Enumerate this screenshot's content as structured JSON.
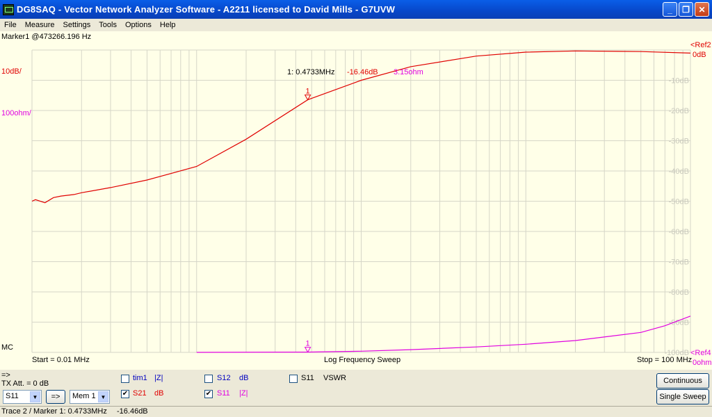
{
  "window": {
    "title": "DG8SAQ  -  Vector Network Analyzer Software  - A2211 licensed to David Mills - G7UVW",
    "minimize": "_",
    "maximize": "❐",
    "close": "✕"
  },
  "menu": [
    "File",
    "Measure",
    "Settings",
    "Tools",
    "Options",
    "Help"
  ],
  "plot": {
    "marker_header": "Marker1 @473266.196 Hz",
    "left_scale_db": "10dB/",
    "left_scale_ohm": "100ohm/",
    "mc_label": "MC",
    "ref2": "<Ref2",
    "ref2_val": "0dB",
    "ref4": "<Ref4",
    "ref4_val": "0ohm",
    "start": "Start = 0.01 MHz",
    "sweep_type": "Log Frequency Sweep",
    "stop": "Stop = 100 MHz",
    "marker_readout": {
      "freq": "1: 0.4733MHz",
      "db": "-16.46dB",
      "ohm": "3.15ohm"
    },
    "marker_label": "1",
    "db_ticks": [
      "-10dB",
      "-20dB",
      "-30dB",
      "-40dB",
      "-50dB",
      "-60dB",
      "-70dB",
      "-80dB",
      "-90dB",
      "-100dB"
    ],
    "colors": {
      "s21": "#e00000",
      "s11": "#e000e0",
      "grid": "#d6d6c8",
      "bg": "#ffffe8"
    }
  },
  "chart_data": {
    "type": "line",
    "xscale": "log",
    "xlim": [
      0.01,
      100
    ],
    "ylim": [
      -100,
      0
    ],
    "series": [
      {
        "name": "S21",
        "unit": "dB",
        "x": [
          0.01,
          0.0105,
          0.012,
          0.0135,
          0.015,
          0.018,
          0.02,
          0.03,
          0.05,
          0.1,
          0.2,
          0.4733,
          1,
          2,
          5,
          10,
          20,
          50,
          100
        ],
        "y": [
          -50,
          -49.5,
          -50.5,
          -48.8,
          -48.3,
          -47.8,
          -47.2,
          -45.5,
          -43,
          -38.5,
          -29.5,
          -16.46,
          -10,
          -5.5,
          -2,
          -0.7,
          -0.3,
          -0.5,
          -1
        ]
      },
      {
        "name": "S11",
        "unit": "|Z|",
        "x": [
          0.1,
          0.4733,
          1,
          2,
          5,
          10,
          20,
          50,
          70,
          100
        ],
        "y": [
          -100,
          -99.9,
          -99.6,
          -99.1,
          -98.2,
          -97.3,
          -96.1,
          -93.4,
          -91.2,
          -88
        ]
      }
    ]
  },
  "controls": {
    "arrow": "=>",
    "tx_att": "TX Att.  = 0 dB",
    "port_select": "S11",
    "transfer_btn": "=>",
    "mem_select": "Mem 1",
    "traces": [
      {
        "name": "tim1",
        "fmt": "|Z|",
        "checked": "",
        "color": "#0000c0"
      },
      {
        "name": "S12",
        "fmt": "dB",
        "checked": "",
        "color": "#0000c0"
      },
      {
        "name": "S11",
        "fmt": "VSWR",
        "checked": "",
        "color": "#000000"
      },
      {
        "name": "S21",
        "fmt": "dB",
        "checked": "✔",
        "color": "#e00000"
      },
      {
        "name": "S11",
        "fmt": "|Z|",
        "checked": "✔",
        "color": "#e000e0"
      }
    ],
    "continuous_btn": "Continuous",
    "single_sweep_btn": "Single Sweep"
  },
  "status": {
    "trace_marker": "Trace 2 / Marker 1: 0.4733MHz",
    "value": "-16.46dB"
  }
}
